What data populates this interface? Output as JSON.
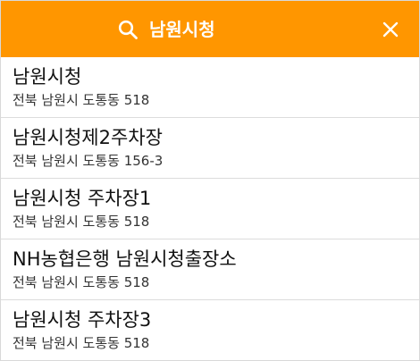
{
  "search": {
    "query": "남원시청",
    "search_icon": "search-icon",
    "close_icon": "close-icon"
  },
  "results": [
    {
      "name": "남원시청",
      "address": "전북 남원시 도통동 518"
    },
    {
      "name": "남원시청제2주차장",
      "address": "전북 남원시 도통동 156-3"
    },
    {
      "name": "남원시청 주차장1",
      "address": "전북 남원시 도통동 518"
    },
    {
      "name": "NH농협은행 남원시청출장소",
      "address": "전북 남원시 도통동 518"
    },
    {
      "name": "남원시청 주차장3",
      "address": "전북 남원시 도통동 518"
    }
  ],
  "colors": {
    "header": "#ff9600",
    "header_text": "#ffffff",
    "divider": "#dcdcdc"
  }
}
